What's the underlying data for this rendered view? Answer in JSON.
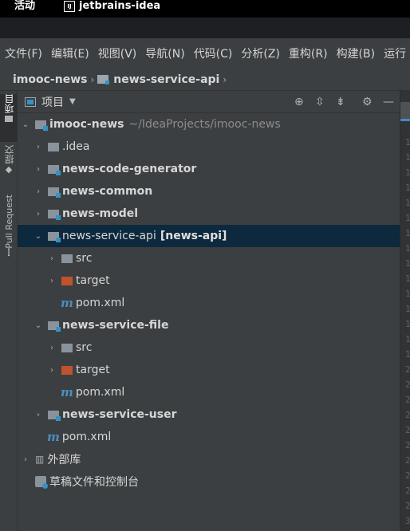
{
  "system_bar": {
    "activities": "活动",
    "app_name": "jetbrains-idea",
    "app_icon_text": "IJ"
  },
  "menu": [
    "文件(F)",
    "编辑(E)",
    "视图(V)",
    "导航(N)",
    "代码(C)",
    "分析(Z)",
    "重构(R)",
    "构建(B)",
    "运行"
  ],
  "breadcrumb": {
    "root": "imooc-news",
    "current": "news-service-api",
    "separator": "›"
  },
  "tool_strip": {
    "project_tab": "项目",
    "commit_tab": "提交",
    "pull_request_tab": "Pull Request"
  },
  "project_panel": {
    "title": "项目",
    "header_icons": [
      "target-icon",
      "expand-all-icon",
      "collapse-all-icon",
      "settings-icon",
      "minimize-icon"
    ]
  },
  "tree": {
    "root": {
      "name": "imooc-news",
      "path": "~/IdeaProjects/imooc-news"
    },
    "idea": ".idea",
    "code_gen": "news-code-generator",
    "common": "news-common",
    "model": "news-model",
    "api": {
      "name": "news-service-api",
      "tag": "[news-api]"
    },
    "api_src": "src",
    "api_target": "target",
    "api_pom": "pom.xml",
    "file": "news-service-file",
    "file_src": "src",
    "file_target": "target",
    "file_pom": "pom.xml",
    "user": "news-service-user",
    "root_pom": "pom.xml",
    "ext_libs": "外部库",
    "scratches": "草稿文件和控制台",
    "maven_glyph": "m"
  },
  "editor": {
    "line_numbers": [
      "1",
      "1",
      "1",
      "1",
      "1",
      "1",
      "1",
      "1",
      "1",
      "1",
      "1",
      "1",
      "1",
      "1",
      "1",
      "2",
      "2",
      "2",
      "2",
      "2",
      "2",
      "2",
      "2",
      "2",
      "2",
      "3",
      "3"
    ]
  }
}
